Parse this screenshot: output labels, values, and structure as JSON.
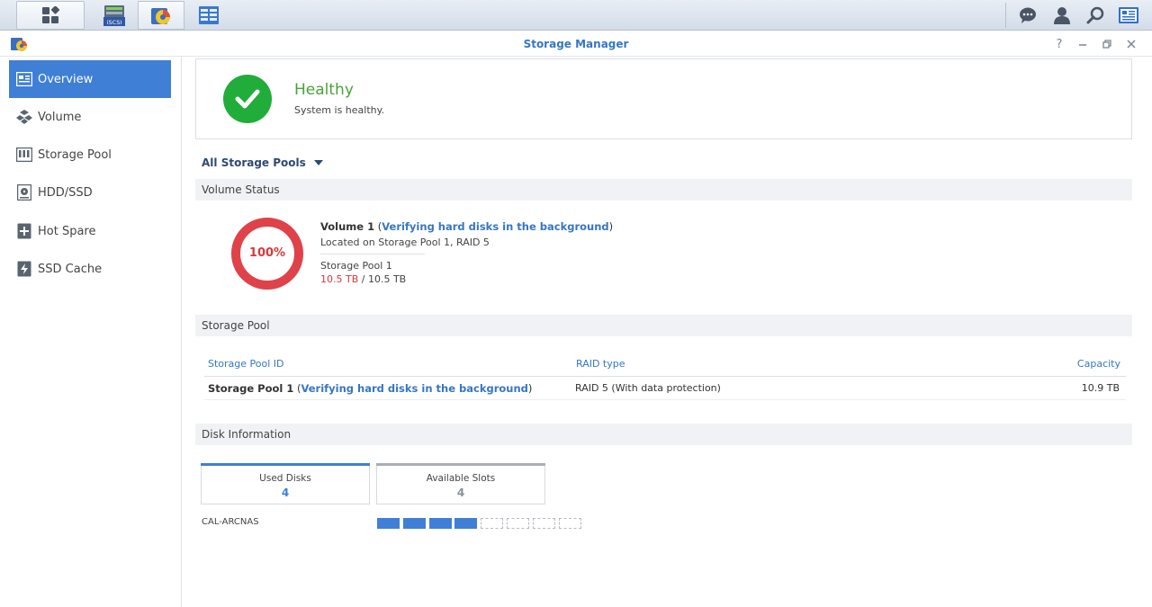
{
  "taskbar": {
    "apps": [
      {
        "name": "iscsi-manager",
        "label": "iSCSI"
      },
      {
        "name": "storage-manager"
      },
      {
        "name": "control-panel"
      }
    ]
  },
  "window": {
    "title": "Storage Manager"
  },
  "sidebar": {
    "items": [
      {
        "label": "Overview",
        "icon": "overview-icon",
        "active": true
      },
      {
        "label": "Volume",
        "icon": "volume-icon"
      },
      {
        "label": "Storage Pool",
        "icon": "storage-pool-icon"
      },
      {
        "label": "HDD/SSD",
        "icon": "hdd-icon"
      },
      {
        "label": "Hot Spare",
        "icon": "hot-spare-icon"
      },
      {
        "label": "SSD Cache",
        "icon": "ssd-cache-icon"
      }
    ]
  },
  "health": {
    "title": "Healthy",
    "subtitle": "System is healthy.",
    "color": "#21ad3a"
  },
  "pool_filter": {
    "selected": "All Storage Pools"
  },
  "volume_status": {
    "section": "Volume Status",
    "percent_label": "100%",
    "usage_fraction": 1.0,
    "volume_name": "Volume 1",
    "open_paren": " (",
    "status": "Verifying hard disks in the background",
    "close_paren": ")",
    "location": "Located on Storage Pool 1, RAID 5",
    "pool": "Storage Pool 1",
    "used": "10.5 TB",
    "separator": " / ",
    "total": "10.5 TB",
    "ring_color": "#e0424a"
  },
  "storage_pool": {
    "section": "Storage Pool",
    "columns": [
      "Storage Pool ID",
      "RAID type",
      "Capacity"
    ],
    "rows": [
      {
        "id": "Storage Pool 1",
        "open_paren": " (",
        "status": "Verifying hard disks in the background",
        "close_paren": ")",
        "raid": "RAID 5 (With data protection)",
        "capacity": "10.9 TB"
      }
    ]
  },
  "disk_info": {
    "section": "Disk Information",
    "used_label": "Used Disks",
    "used_count": "4",
    "available_label": "Available Slots",
    "available_count": "4",
    "nas_name": "CAL-ARCNAS",
    "slots_used": 4,
    "slots_total": 8,
    "accent": "#3f7fd6"
  }
}
